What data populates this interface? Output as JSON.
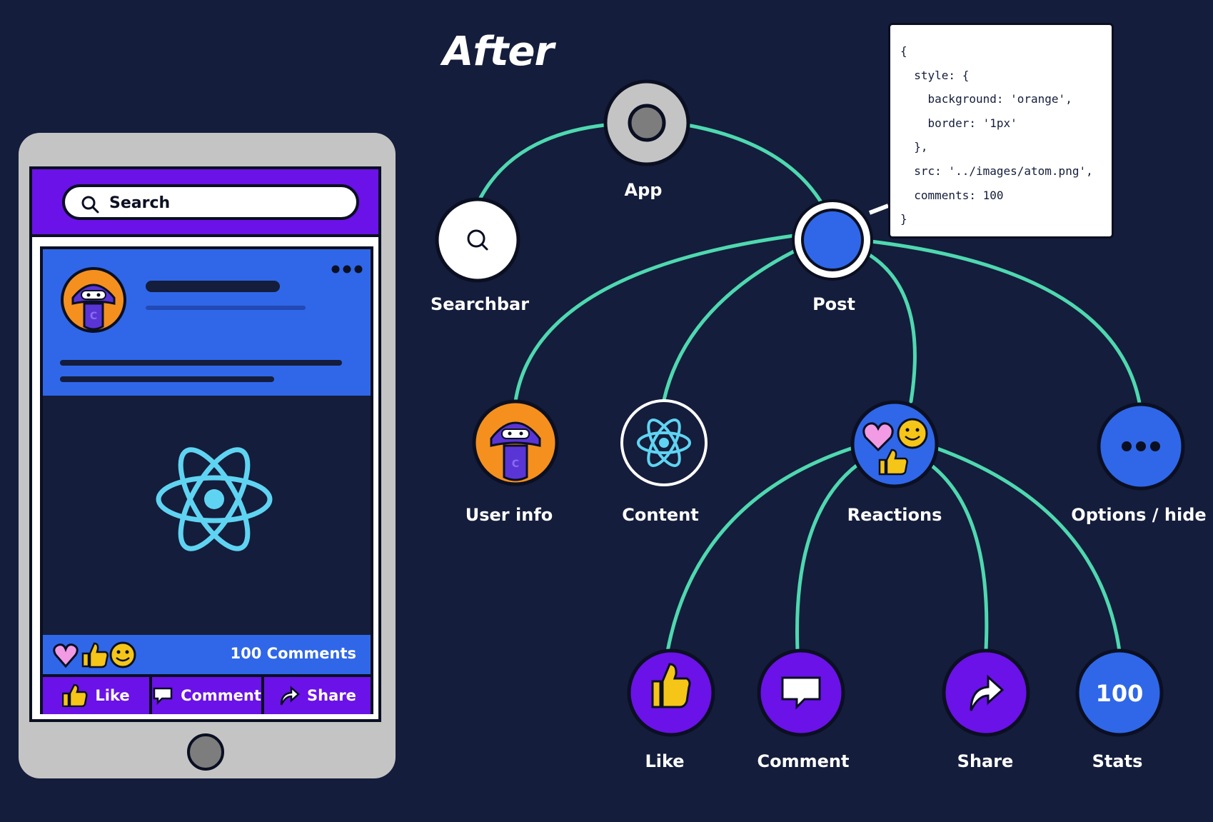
{
  "title": "After",
  "phone": {
    "search_placeholder": "Search",
    "comments_count_label": "100 Comments",
    "actions": [
      {
        "label": "Like",
        "icon": "thumbs-up-icon"
      },
      {
        "label": "Comment",
        "icon": "speech-bubble-icon"
      },
      {
        "label": "Share",
        "icon": "share-arrow-icon"
      }
    ]
  },
  "tree": {
    "nodes": [
      {
        "id": "app",
        "label": "App",
        "icon": "app-root-icon"
      },
      {
        "id": "searchbar",
        "label": "Searchbar",
        "icon": "search-icon"
      },
      {
        "id": "post",
        "label": "Post",
        "icon": "post-icon"
      },
      {
        "id": "userinfo",
        "label": "User info",
        "icon": "avatar-icon"
      },
      {
        "id": "content",
        "label": "Content",
        "icon": "react-atom-icon"
      },
      {
        "id": "reactions",
        "label": "Reactions",
        "icon": "reactions-icon"
      },
      {
        "id": "options",
        "label": "Options / hide",
        "icon": "ellipsis-icon"
      },
      {
        "id": "like",
        "label": "Like",
        "icon": "thumbs-up-icon"
      },
      {
        "id": "comment",
        "label": "Comment",
        "icon": "speech-bubble-icon"
      },
      {
        "id": "share",
        "label": "Share",
        "icon": "share-arrow-icon"
      },
      {
        "id": "stats",
        "label": "Stats",
        "icon": "stats-icon",
        "value": "100"
      }
    ],
    "edges": [
      [
        "app",
        "searchbar"
      ],
      [
        "app",
        "post"
      ],
      [
        "post",
        "userinfo"
      ],
      [
        "post",
        "content"
      ],
      [
        "post",
        "reactions"
      ],
      [
        "post",
        "options"
      ],
      [
        "reactions",
        "like"
      ],
      [
        "reactions",
        "comment"
      ],
      [
        "reactions",
        "share"
      ],
      [
        "reactions",
        "stats"
      ]
    ]
  },
  "code": {
    "lines": [
      "{",
      "  style: {",
      "    background: 'orange',",
      "    border: '1px'",
      "  },",
      "  src: '../images/atom.png',",
      "  comments: 100",
      "}"
    ]
  },
  "colors": {
    "background": "#141d3b",
    "edge": "#4fd8b0",
    "purple": "#6a12e8",
    "blue": "#2f67e8",
    "react_cyan": "#5fd4f2",
    "orange": "#f5901e"
  }
}
